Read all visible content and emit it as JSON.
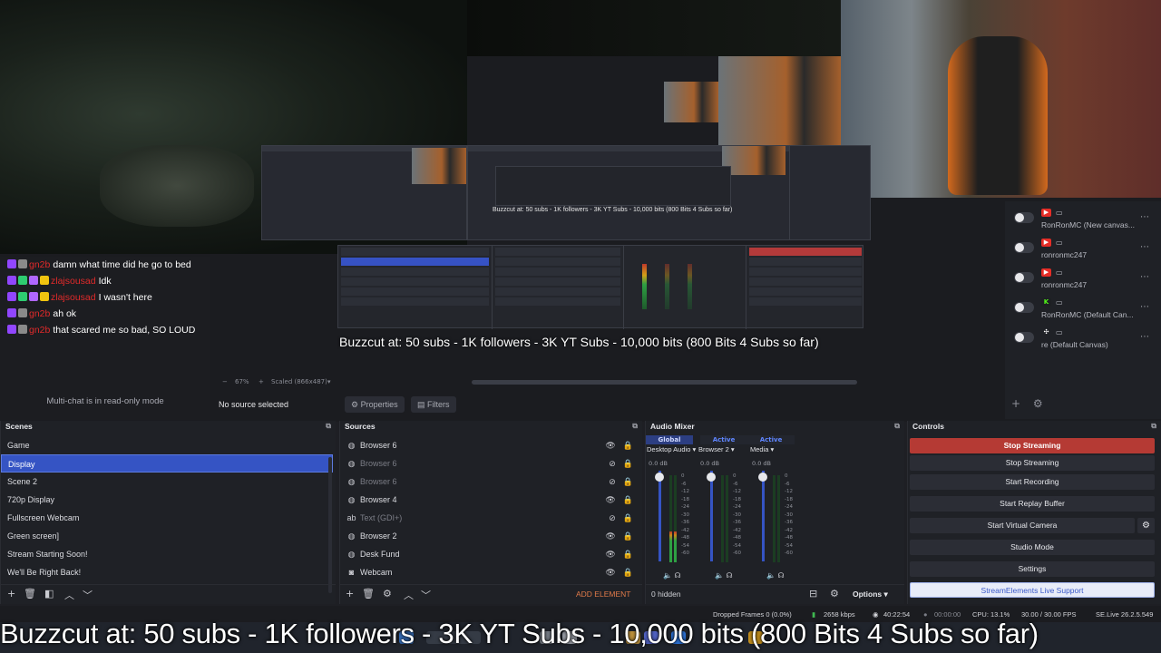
{
  "overlay": {
    "ticker_text": "Buzzcut at: 50 subs - 1K followers - 3K YT Subs - 10,000 bits (800 Bits 4 Subs so far)"
  },
  "chat": {
    "messages": [
      {
        "user": "gn2b",
        "text": "damn what time did he go to bed"
      },
      {
        "user": "zlajsousad",
        "text": "Idk"
      },
      {
        "user": "zlajsousad",
        "text": "I wasn't here"
      },
      {
        "user": "gn2b",
        "text": "ah ok"
      },
      {
        "user": "gn2b",
        "text": "that scared me so bad, SO LOUD"
      }
    ],
    "readonly_label": "Multi-chat is in read-only mode"
  },
  "preview": {
    "zoom": "67%",
    "scaled": "Scaled (866x487)",
    "no_source": "No source selected",
    "properties_label": "Properties",
    "filters_label": "Filters"
  },
  "canvases": [
    {
      "platform": "youtube-icon",
      "name": "RonRonMC (New canvas..."
    },
    {
      "platform": "youtube-icon",
      "name": "ronronmc247"
    },
    {
      "platform": "youtube-icon",
      "name": "ronronmc247"
    },
    {
      "platform": "kick-icon",
      "name": "RonRonMC (Default Can..."
    },
    {
      "platform": "multi-icon",
      "name": "re (Default Canvas)"
    }
  ],
  "scenes": {
    "title": "Scenes",
    "items": [
      "Game",
      "Display",
      "Scene 2",
      "720p Display",
      "Fullscreen Webcam",
      "Green screen]",
      "Stream Starting Soon!",
      "We'll Be Right Back!"
    ],
    "selected": "Display"
  },
  "sources": {
    "title": "Sources",
    "items": [
      {
        "icon": "globe-icon",
        "name": "Browser 6",
        "visible": true
      },
      {
        "icon": "globe-icon",
        "name": "Browser 6",
        "visible": false
      },
      {
        "icon": "globe-icon",
        "name": "Browser 6",
        "visible": false
      },
      {
        "icon": "globe-icon",
        "name": "Browser 4",
        "visible": true
      },
      {
        "icon": "text-icon",
        "name": "Text (GDI+)",
        "visible": false
      },
      {
        "icon": "globe-icon",
        "name": "Browser 2",
        "visible": true
      },
      {
        "icon": "globe-icon",
        "name": "Desk Fund",
        "visible": true
      },
      {
        "icon": "camera-icon",
        "name": "Webcam",
        "visible": true
      }
    ],
    "add_element": "ADD ELEMENT"
  },
  "mixer": {
    "title": "Audio Mixer",
    "tabs": [
      "Global",
      "Active",
      "Active"
    ],
    "channels": [
      {
        "name": "Desktop Audio",
        "db": "0.0 dB",
        "level": 0.35
      },
      {
        "name": "Browser 2",
        "db": "0.0 dB",
        "level": 0.0
      },
      {
        "name": "Media",
        "db": "0.0 dB",
        "level": 0.0
      }
    ],
    "scale": [
      "0",
      "-6",
      "-12",
      "-18",
      "-24",
      "-30",
      "-36",
      "-42",
      "-48",
      "-54",
      "-60"
    ],
    "hidden_label": "0 hidden",
    "options_label": "Options"
  },
  "controls": {
    "title": "Controls",
    "buttons": [
      "Stop Streaming",
      "Stop Streaming",
      "Start Recording",
      "Start Replay Buffer",
      "Start Virtual Camera",
      "Studio Mode",
      "Settings",
      "StreamElements Live Support"
    ]
  },
  "status": {
    "dropped": "Dropped Frames 0 (0.0%)",
    "kbps": "2658 kbps",
    "stream_time": "40:22:54",
    "rec_time": "00:00:00",
    "cpu": "CPU: 13.1%",
    "fps": "30.00 / 30.00 FPS",
    "version": "SE.Live 26.2.5.549"
  }
}
